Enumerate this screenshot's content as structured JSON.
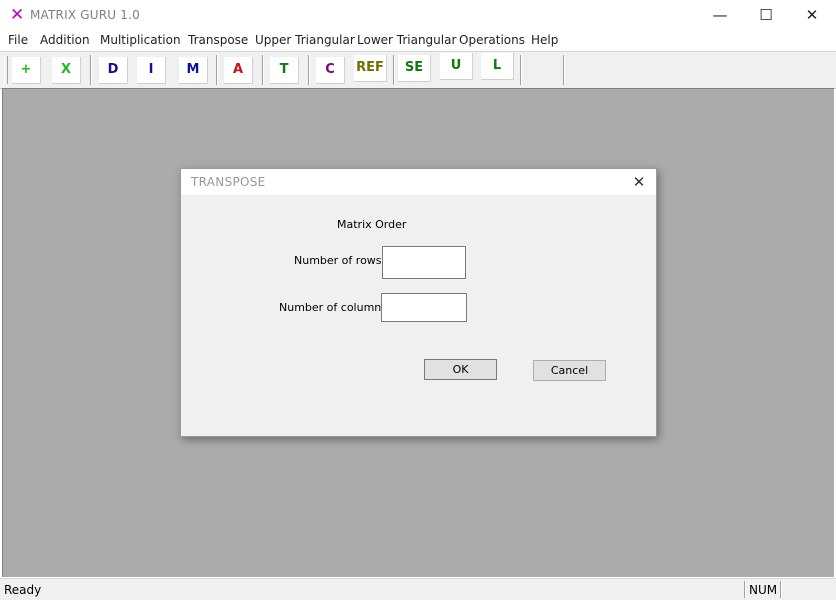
{
  "window": {
    "title": "MATRIX GURU 1.0",
    "icon": "x-icon",
    "icon_glyph": "✕",
    "icon_color": "#c000c0",
    "minimize_glyph": "—",
    "maximize_glyph": "☐",
    "close_glyph": "✕"
  },
  "menu": {
    "items": [
      "File",
      "Addition",
      "Multiplication",
      "Transpose",
      "Upper Triangular",
      "Lower Triangular",
      "Operations",
      "Help"
    ]
  },
  "toolbar": {
    "buttons": [
      {
        "label": "+",
        "color": "#22bb22"
      },
      {
        "label": "X",
        "color": "#22bb22"
      },
      {
        "label": "D",
        "color": "#1010a0"
      },
      {
        "label": "I",
        "color": "#1010a0"
      },
      {
        "label": "M",
        "color": "#1010a0"
      },
      {
        "label": "A",
        "color": "#cc1111"
      },
      {
        "label": "T",
        "color": "#117711"
      },
      {
        "label": "C",
        "color": "#800080"
      },
      {
        "label": "REF",
        "color": "#707000"
      },
      {
        "label": "SE",
        "color": "#117711"
      },
      {
        "label": "U",
        "color": "#117711"
      },
      {
        "label": "L",
        "color": "#117711"
      }
    ]
  },
  "workspace": {
    "background": "#ababab"
  },
  "dialog": {
    "title": "TRANSPOSE",
    "close_glyph": "✕",
    "heading": "Matrix Order",
    "rows_label": "Number of rows:",
    "rows_value": "",
    "columns_label": "Number of columns:",
    "columns_value": "",
    "ok_label": "OK",
    "cancel_label": "Cancel"
  },
  "status": {
    "text": "Ready",
    "num": "NUM"
  }
}
